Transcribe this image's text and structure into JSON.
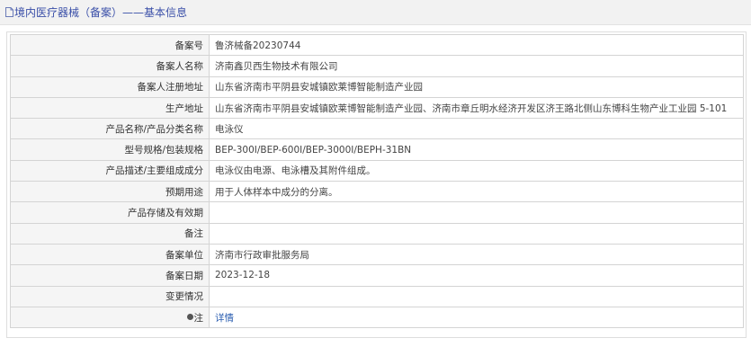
{
  "header": {
    "title": "境内医疗器械（备案）",
    "dash": "——",
    "subtitle": "基本信息"
  },
  "rows": [
    {
      "label": "备案号",
      "value": "鲁济械备20230744"
    },
    {
      "label": "备案人名称",
      "value": "济南鑫贝西生物技术有限公司"
    },
    {
      "label": "备案人注册地址",
      "value": "山东省济南市平阴县安城镇欧莱博智能制造产业园"
    },
    {
      "label": "生产地址",
      "value": "山东省济南市平阴县安城镇欧莱博智能制造产业园、济南市章丘明水经济开发区济王路北侧山东博科生物产业工业园 5-101"
    },
    {
      "label": "产品名称/产品分类名称",
      "value": "电泳仪"
    },
    {
      "label": "型号规格/包装规格",
      "value": "BEP-300Ⅰ/BEP-600Ⅰ/BEP-3000Ⅰ/BEPH-31BN"
    },
    {
      "label": "产品描述/主要组成成分",
      "value": "电泳仪由电源、电泳槽及其附件组成。"
    },
    {
      "label": "预期用途",
      "value": "用于人体样本中成分的分离。"
    },
    {
      "label": "产品存储及有效期",
      "value": ""
    },
    {
      "label": "备注",
      "value": ""
    },
    {
      "label": "备案单位",
      "value": "济南市行政审批服务局"
    },
    {
      "label": "备案日期",
      "value": "2023-12-18"
    },
    {
      "label": "变更情况",
      "value": ""
    },
    {
      "label": "注",
      "value": "详情"
    }
  ]
}
